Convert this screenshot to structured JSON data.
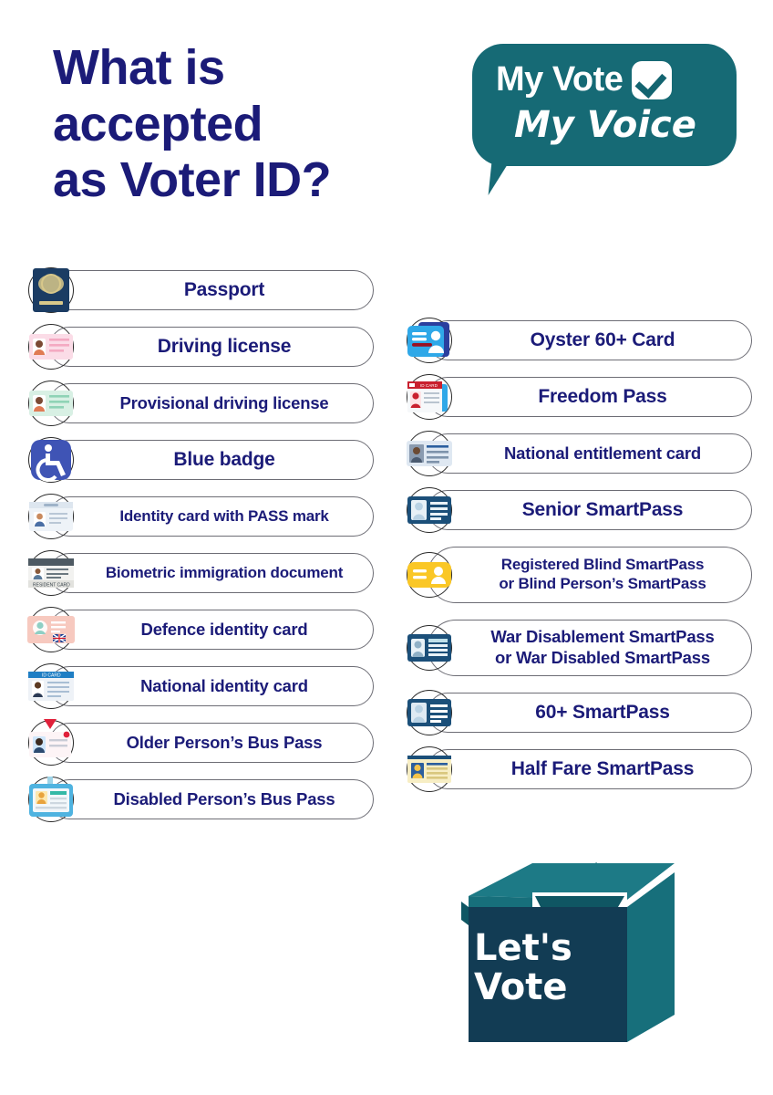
{
  "header": {
    "title": "What is\naccepted\nas Voter ID?",
    "title_color": "#1b1b78"
  },
  "logo": {
    "line1": "My Vote",
    "line2": "My Voice",
    "checkbox_icon": "checkbox-checked-icon",
    "bubble_color": "#166a75",
    "text_color": "#ffffff"
  },
  "left_column": {
    "items": [
      {
        "label": "Passport",
        "icon": "passport-icon",
        "lines": 1
      },
      {
        "label": "Driving license",
        "icon": "driving-license-icon",
        "lines": 1
      },
      {
        "label": "Provisional driving license",
        "icon": "provisional-driving-license-icon",
        "lines": 1
      },
      {
        "label": "Blue badge",
        "icon": "blue-badge-icon",
        "lines": 1
      },
      {
        "label": "Identity card with PASS mark",
        "icon": "pass-mark-id-card-icon",
        "lines": 1
      },
      {
        "label": "Biometric immigration document",
        "icon": "resident-card-icon",
        "lines": 1
      },
      {
        "label": "Defence identity card",
        "icon": "defence-id-card-icon",
        "lines": 1
      },
      {
        "label": "National identity card",
        "icon": "national-id-card-icon",
        "lines": 1
      },
      {
        "label": "Older Person’s Bus Pass",
        "icon": "older-person-bus-pass-icon",
        "lines": 1
      },
      {
        "label": "Disabled Person’s Bus Pass",
        "icon": "disabled-person-bus-pass-icon",
        "lines": 1
      }
    ]
  },
  "right_column": {
    "items": [
      {
        "label": "Oyster 60+ Card",
        "icon": "oyster-card-icon",
        "lines": 1
      },
      {
        "label": "Freedom Pass",
        "icon": "freedom-pass-icon",
        "lines": 1
      },
      {
        "label": "National entitlement card",
        "icon": "national-entitlement-card-icon",
        "lines": 1
      },
      {
        "label": "Senior SmartPass",
        "icon": "senior-smartpass-icon",
        "lines": 1
      },
      {
        "label": "Registered Blind SmartPass\nor Blind Person’s SmartPass",
        "icon": "registered-blind-smartpass-icon",
        "lines": 2
      },
      {
        "label": "War Disablement SmartPass\nor War Disabled SmartPass",
        "icon": "war-disablement-smartpass-icon",
        "lines": 2
      },
      {
        "label": "60+ SmartPass",
        "icon": "sixty-plus-smartpass-icon",
        "lines": 1
      },
      {
        "label": "Half Fare SmartPass",
        "icon": "half-fare-smartpass-icon",
        "lines": 1
      }
    ]
  },
  "ballot": {
    "text": "Let's\nVote",
    "check_icon": "checkmark-icon",
    "box_front_color": "#123c54",
    "box_top_color": "#166a75",
    "text_color": "#ffffff"
  }
}
